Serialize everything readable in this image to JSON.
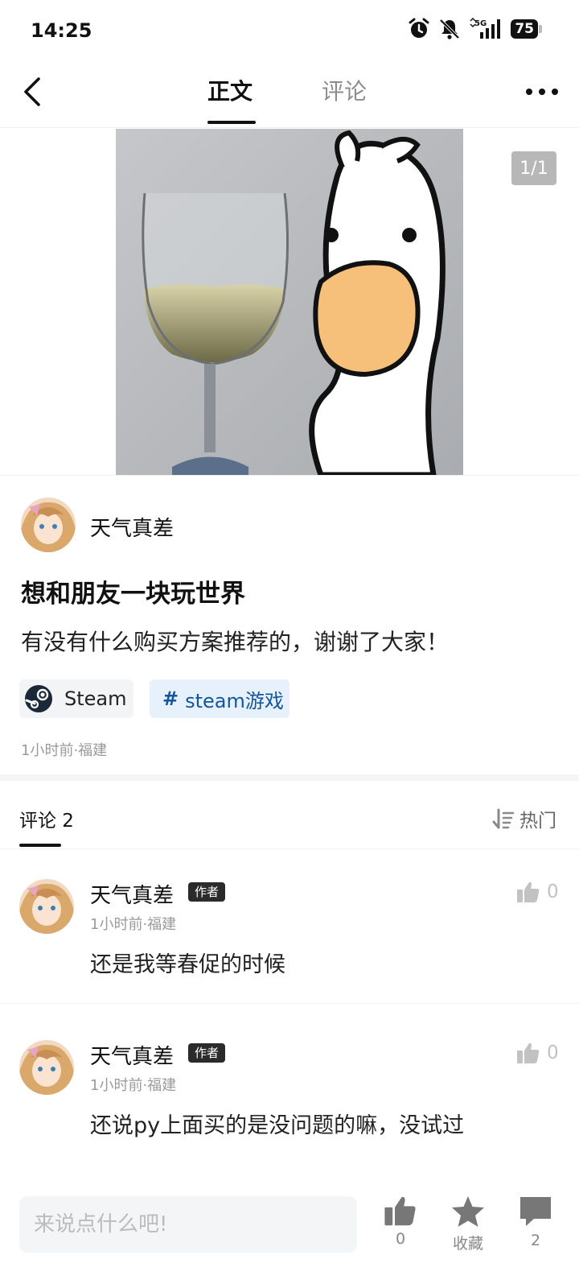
{
  "status": {
    "time": "14:25",
    "battery": "75",
    "network": "5G"
  },
  "nav": {
    "tab_main": "正文",
    "tab_comments": "评论"
  },
  "image": {
    "counter": "1/1"
  },
  "post": {
    "author": "天气真差",
    "title": "想和朋友一块玩世界",
    "body": "有没有什么购买方案推荐的，谢谢了大家！",
    "tags": {
      "steam": "Steam",
      "topic": "steam游戏",
      "topic_hash": "#"
    },
    "meta": "1小时前·福建"
  },
  "comments": {
    "header": "评论 2",
    "sort_label": "热门",
    "items": [
      {
        "author": "天气真差",
        "badge": "作者",
        "meta": "1小时前·福建",
        "text": "还是我等春促的时候",
        "likes": "0"
      },
      {
        "author": "天气真差",
        "badge": "作者",
        "meta": "1小时前·福建",
        "text": "还说py上面买的是没问题的嘛，没试过",
        "likes": "0"
      }
    ]
  },
  "bottom": {
    "input_placeholder": "来说点什么吧!",
    "like_count": "0",
    "favorite_label": "收藏",
    "comment_count": "2"
  },
  "colors": {
    "topic_tag_bg": "#e6f1fb",
    "topic_tag_text": "#14569e",
    "avatar_accent": "#e8a4c0"
  }
}
